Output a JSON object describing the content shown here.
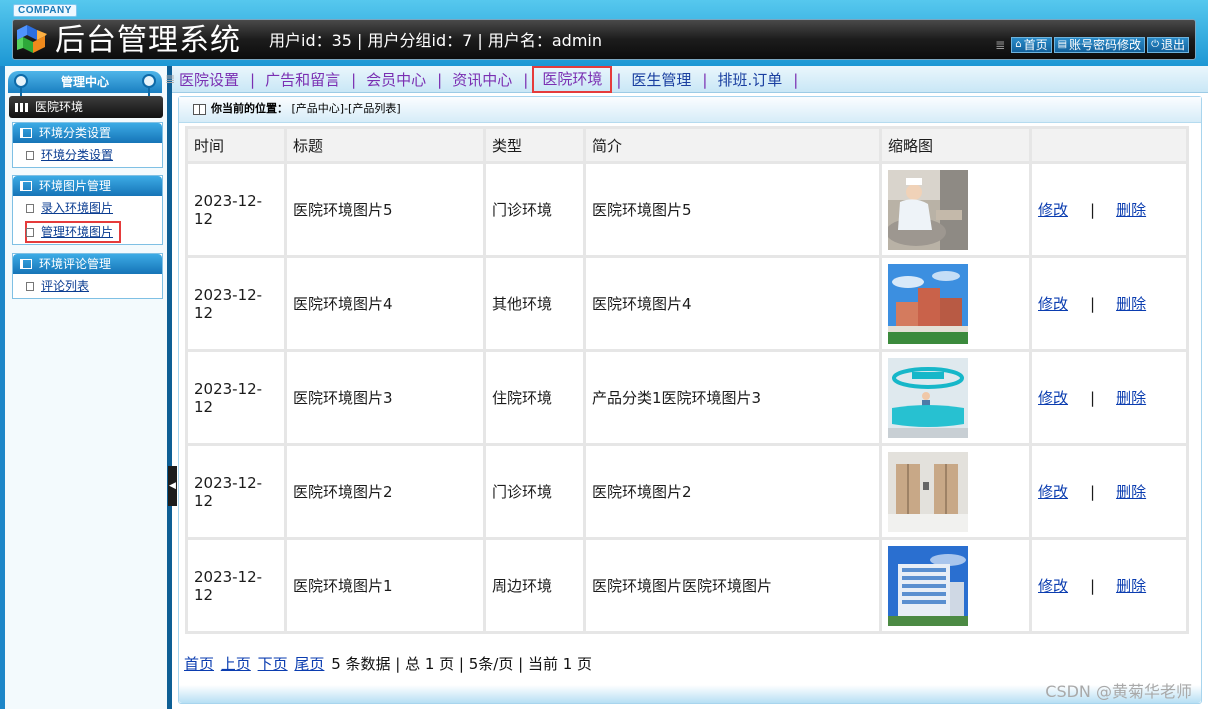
{
  "header": {
    "company": "COMPANY",
    "title": "后台管理系统",
    "user_info": "用户id：35 | 用户分组id：7 | 用户名：admin",
    "actions": [
      {
        "label": "首页",
        "icon": "home-icon"
      },
      {
        "label": "账号密码修改",
        "icon": "document-icon"
      },
      {
        "label": "退出",
        "icon": "power-icon"
      }
    ]
  },
  "sidebar": {
    "top_label": "管理中心",
    "section_title": "医院环境",
    "groups": [
      {
        "title": "环境分类设置",
        "items": [
          "环境分类设置"
        ]
      },
      {
        "title": "环境图片管理",
        "items": [
          "录入环境图片",
          "管理环境图片"
        ]
      },
      {
        "title": "环境评论管理",
        "items": [
          "评论列表"
        ]
      }
    ],
    "selected_item": "管理环境图片"
  },
  "nav": {
    "items": [
      "医院设置",
      "广告和留言",
      "会员中心",
      "资讯中心",
      "医院环境",
      "医生管理",
      "排班.订单"
    ],
    "active": "医院环境"
  },
  "breadcrumb": {
    "prefix": "你当前的位置：",
    "path": "[产品中心]-[产品列表]"
  },
  "table": {
    "columns": [
      "时间",
      "标题",
      "类型",
      "简介",
      "缩略图",
      ""
    ],
    "rows": [
      {
        "time": "2023-12-12",
        "title": "医院环境图片5",
        "type": "门诊环境",
        "intro": "医院环境图片5",
        "thumb": "nurse-photo",
        "edit": "修改",
        "sep": "|",
        "delete": "删除"
      },
      {
        "time": "2023-12-12",
        "title": "医院环境图片4",
        "type": "其他环境",
        "intro": "医院环境图片4",
        "thumb": "hospital-building-photo",
        "edit": "修改",
        "sep": "|",
        "delete": "删除"
      },
      {
        "time": "2023-12-12",
        "title": "医院环境图片3",
        "type": "住院环境",
        "intro": "产品分类1医院环境图片3",
        "thumb": "service-desk-photo",
        "edit": "修改",
        "sep": "|",
        "delete": "删除"
      },
      {
        "time": "2023-12-12",
        "title": "医院环境图片2",
        "type": "门诊环境",
        "intro": "医院环境图片2",
        "thumb": "elevator-photo",
        "edit": "修改",
        "sep": "|",
        "delete": "删除"
      },
      {
        "time": "2023-12-12",
        "title": "医院环境图片1",
        "type": "周边环境",
        "intro": "医院环境图片医院环境图片",
        "thumb": "building-exterior-photo",
        "edit": "修改",
        "sep": "|",
        "delete": "删除"
      }
    ]
  },
  "pager": {
    "links": [
      "首页",
      "上页",
      "下页",
      "尾页"
    ],
    "summary": "5 条数据 | 总 1 页 | 5条/页 | 当前 1 页"
  },
  "watermark": "CSDN @黄菊华老师",
  "colors": {
    "header_blue": "#1d97d4",
    "nav_text": "#7a2fb2",
    "highlight_red": "#e53b3b",
    "link_blue": "#0b3db0"
  }
}
